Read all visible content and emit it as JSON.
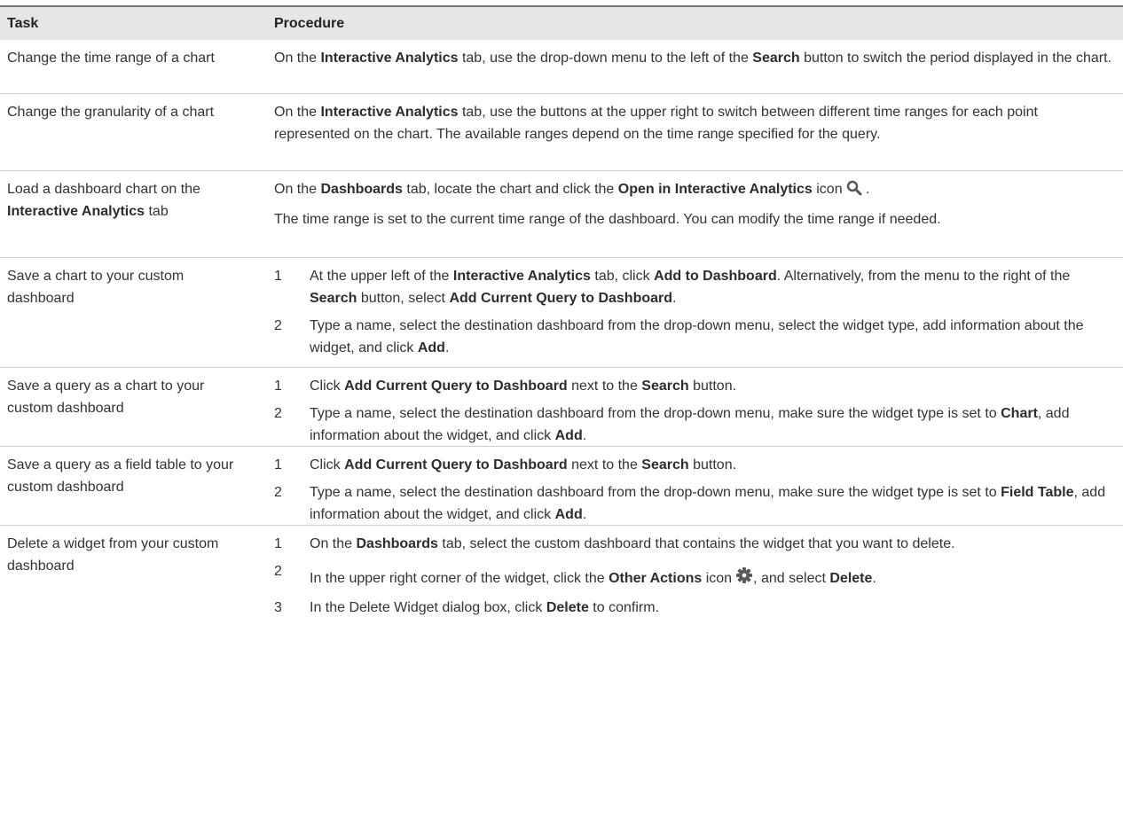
{
  "header": {
    "task": "Task",
    "procedure": "Procedure"
  },
  "rows": [
    {
      "task": "Change the time range of a chart",
      "proc": {
        "t1": "On the ",
        "b1": "Interactive Analytics",
        "t2": " tab, use the drop-down menu to the left of the ",
        "b2": "Search",
        "t3": " button to switch the period displayed in the chart."
      }
    },
    {
      "task": "Change the granularity of a chart",
      "proc": {
        "t1": "On the ",
        "b1": "Interactive Analytics",
        "t2": " tab, use the buttons at the upper right to switch between different time ranges for each point represented on the chart. The available ranges depend on the time range specified for the query."
      }
    },
    {
      "task": {
        "t1": "Load a dashboard chart on the ",
        "b1": "Interactive Analytics",
        "t2": " tab"
      },
      "proc": {
        "t1": "On the ",
        "b1": "Dashboards",
        "t2": " tab, locate the chart and click the ",
        "b2": "Open in Interactive Analytics",
        "t3": " icon",
        "t4": " .",
        "icon": "magnifier-icon",
        "note": "The time range is set to the current time range of the dashboard. You can modify the time range if needed."
      }
    },
    {
      "task": "Save a chart to your custom dashboard",
      "steps": [
        {
          "num": "1",
          "t1": "At the upper left of the ",
          "b1": "Interactive Analytics",
          "t2": " tab, click ",
          "b2": "Add to Dashboard",
          "t3": ". Alternatively, from the menu to the right of the ",
          "b3": "Search",
          "t4": " button, select ",
          "b4": "Add Current Query to Dashboard",
          "t5": "."
        },
        {
          "num": "2",
          "t1": "Type a name, select the destination dashboard from the drop-down menu, select the widget type, add information about the widget, and click ",
          "b1": "Add",
          "t2": "."
        }
      ]
    },
    {
      "task": "Save a query as a chart to your custom dashboard",
      "steps": [
        {
          "num": "1",
          "t1": "Click ",
          "b1": "Add Current Query to Dashboard",
          "t2": " next to the ",
          "b2": "Search",
          "t3": " button."
        },
        {
          "num": "2",
          "t1": "Type a name, select the destination dashboard from the drop-down menu, make sure the widget type is set to ",
          "b1": "Chart",
          "t2": ", add information about the widget, and click ",
          "b2": "Add",
          "t3": "."
        }
      ]
    },
    {
      "task": "Save a query as a field table to your custom dashboard",
      "steps": [
        {
          "num": "1",
          "t1": "Click ",
          "b1": "Add Current Query to Dashboard",
          "t2": " next to the ",
          "b2": "Search",
          "t3": " button."
        },
        {
          "num": "2",
          "t1": "Type a name, select the destination dashboard from the drop-down menu, make sure the widget type is set to ",
          "b1": "Field Table",
          "t2": ", add information about the widget, and click ",
          "b2": "Add",
          "t3": "."
        }
      ]
    },
    {
      "task": "Delete a widget from your custom dashboard",
      "steps": [
        {
          "num": "1",
          "t1": "On the ",
          "b1": "Dashboards",
          "t2": " tab, select the custom dashboard that contains the widget that you want to delete."
        },
        {
          "num": "2",
          "t1": "In the upper right corner of the widget, click the ",
          "b1": "Other Actions",
          "t2": " icon",
          "t3": ", and select ",
          "b2": "Delete",
          "t4": ".",
          "icon": "gear-icon"
        },
        {
          "num": "3",
          "t1": "In the Delete Widget dialog box, click ",
          "b1": "Delete",
          "t2": " to confirm."
        }
      ]
    }
  ]
}
